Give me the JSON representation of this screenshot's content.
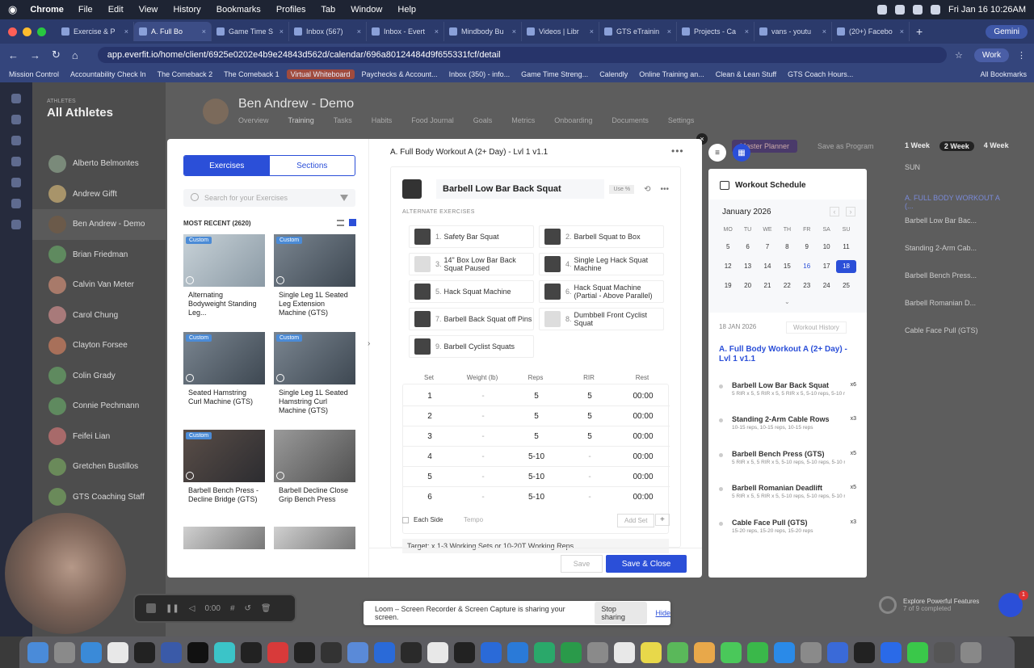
{
  "mac_menu": {
    "apple": "",
    "app": "Chrome",
    "items": [
      "File",
      "Edit",
      "View",
      "History",
      "Bookmarks",
      "Profiles",
      "Tab",
      "Window",
      "Help"
    ],
    "clock": "Fri Jan 16  10:26AM"
  },
  "tabs": [
    {
      "label": "Exercise & P",
      "active": false
    },
    {
      "label": "A. Full Bo",
      "active": true
    },
    {
      "label": "Game Time S",
      "active": false
    },
    {
      "label": "Inbox (567)",
      "active": false
    },
    {
      "label": "Inbox - Evert",
      "active": false
    },
    {
      "label": "Mindbody Bu",
      "active": false
    },
    {
      "label": "Videos | Libr",
      "active": false
    },
    {
      "label": "GTS eTrainin",
      "active": false
    },
    {
      "label": "Projects - Ca",
      "active": false
    },
    {
      "label": "vans - youtu",
      "active": false
    },
    {
      "label": "(20+) Facebo",
      "active": false
    }
  ],
  "gemini": "Gemini",
  "address": "app.everfit.io/home/client/6925e0202e4b9e24843d562d/calendar/696a80124484d9f655331fcf/detail",
  "profile": "Work",
  "bookmarks": [
    "Mission Control",
    "Accountability Check In",
    "The Comeback 2",
    "The Comeback 1",
    "Virtual Whiteboard",
    "Paychecks & Account...",
    "Inbox (350) - info...",
    "Game Time Streng...",
    "Calendly",
    "Online Training an...",
    "Clean & Lean Stuff",
    "GTS Coach Hours...",
    "All Bookmarks"
  ],
  "athletes": {
    "label": "ATHLETES",
    "title": "All Athletes",
    "list": [
      "Alberto Belmontes",
      "Andrew Gifft",
      "Ben Andrew - Demo",
      "Brian Friedman",
      "Calvin Van Meter",
      "Carol Chung",
      "Clayton Forsee",
      "Colin Grady",
      "Connie Pechmann",
      "Feifei Lian",
      "Gretchen Bustillos",
      "GTS Coaching Staff"
    ]
  },
  "client": {
    "name": "Ben Andrew - Demo",
    "tabs": [
      "Overview",
      "Training",
      "Tasks",
      "Habits",
      "Food Journal",
      "Goals",
      "Metrics",
      "Onboarding",
      "Documents",
      "Settings"
    ]
  },
  "calendar_header": {
    "master_planner": "Master Planner",
    "save_as_program": "Save as Program",
    "weeks": [
      "1 Week",
      "2 Week",
      "4 Week"
    ]
  },
  "ghost_column": {
    "sun": "SUN",
    "items": [
      "A. FULL BODY WORKOUT A (...",
      "Barbell Low Bar Bac...",
      "Standing 2-Arm Cab...",
      "Barbell Bench Press...",
      "Barbell Romanian D...",
      "Cable Face Pull (GTS)"
    ]
  },
  "library": {
    "seg_exercises": "Exercises",
    "seg_sections": "Sections",
    "search_placeholder": "Search for your Exercises",
    "most_recent": "MOST RECENT (2620)",
    "cards": [
      {
        "tag": "Custom",
        "title": "Alternating Bodyweight Standing Leg..."
      },
      {
        "tag": "Custom",
        "title": "Single Leg 1L Seated Leg Extension Machine (GTS)"
      },
      {
        "tag": "Custom",
        "title": "Seated Hamstring Curl Machine (GTS)"
      },
      {
        "tag": "Custom",
        "title": "Single Leg 1L Seated Hamstring Curl Machine (GTS)"
      },
      {
        "tag": "Custom",
        "title": "Barbell Bench Press - Decline Bridge (GTS)"
      },
      {
        "tag": "",
        "title": "Barbell Decline Close Grip Bench Press"
      }
    ]
  },
  "editor": {
    "title": "A. Full Body Workout A (2+ Day) - Lvl 1 v1.1",
    "exercise": "Barbell Low Bar Back Squat",
    "use_pct": "Use %",
    "alt_label": "ALTERNATE EXERCISES",
    "alternates": [
      {
        "n": "1.",
        "name": "Safety Bar Squat"
      },
      {
        "n": "2.",
        "name": "Barbell Squat to Box"
      },
      {
        "n": "3.",
        "name": "14\" Box Low Bar Back Squat Paused"
      },
      {
        "n": "4.",
        "name": "Single Leg Hack Squat Machine"
      },
      {
        "n": "5.",
        "name": "Hack Squat Machine"
      },
      {
        "n": "6.",
        "name": "Hack Squat Machine (Partial - Above Parallel)"
      },
      {
        "n": "7.",
        "name": "Barbell Back Squat off Pins"
      },
      {
        "n": "8.",
        "name": "Dumbbell Front Cyclist Squat"
      },
      {
        "n": "9.",
        "name": "Barbell Cyclist Squats"
      }
    ],
    "set_headers": [
      "Set",
      "Weight (lb)",
      "Reps",
      "RIR",
      "Rest"
    ],
    "sets": [
      {
        "set": "1",
        "weight": "-",
        "reps": "5",
        "rir": "5",
        "rest": "00:00"
      },
      {
        "set": "2",
        "weight": "-",
        "reps": "5",
        "rir": "5",
        "rest": "00:00"
      },
      {
        "set": "3",
        "weight": "-",
        "reps": "5",
        "rir": "5",
        "rest": "00:00"
      },
      {
        "set": "4",
        "weight": "-",
        "reps": "5-10",
        "rir": "-",
        "rest": "00:00"
      },
      {
        "set": "5",
        "weight": "-",
        "reps": "5-10",
        "rir": "-",
        "rest": "00:00"
      },
      {
        "set": "6",
        "weight": "-",
        "reps": "5-10",
        "rir": "-",
        "rest": "00:00"
      }
    ],
    "each_side": "Each Side",
    "tempo": "Tempo",
    "add_set": "Add Set",
    "plus": "+",
    "target": "Target: x 1-3 Working Sets or 10-20T Working Reps",
    "save": "Save",
    "save_close": "Save & Close"
  },
  "schedule": {
    "title": "Workout Schedule",
    "month": "January 2026",
    "dows": [
      "MO",
      "TU",
      "WE",
      "TH",
      "FR",
      "SA",
      "SU"
    ],
    "weeks": [
      [
        "5",
        "6",
        "7",
        "8",
        "9",
        "10",
        "11"
      ],
      [
        "12",
        "13",
        "14",
        "15",
        "16",
        "17",
        "18"
      ],
      [
        "19",
        "20",
        "21",
        "22",
        "23",
        "24",
        "25"
      ]
    ],
    "date": "18 JAN 2026",
    "history": "Workout History",
    "workout": "A. Full Body Workout A (2+ Day) - Lvl 1 v1.1",
    "items": [
      {
        "name": "Barbell Low Bar Back Squat",
        "detail": "5 RIR x 5, 5 RIR x 5, 5 RIR x 5, 5-10 reps, 5-10 re",
        "x": "x6"
      },
      {
        "name": "Standing 2-Arm Cable Rows",
        "detail": "10-15 reps, 10-15 reps, 10-15 reps",
        "x": "x3"
      },
      {
        "name": "Barbell Bench Press (GTS)",
        "detail": "5 RIR x 5, 5 RIR x 5, 5-10 reps, 5-10 reps, 5-10 re",
        "x": "x5"
      },
      {
        "name": "Barbell Romanian Deadlift",
        "detail": "5 RIR x 5, 5 RIR x 5, 5-10 reps, 5-10 reps, 5-10 re",
        "x": "x5"
      },
      {
        "name": "Cable Face Pull (GTS)",
        "detail": "15-20 reps, 15-20 reps, 15-20 reps",
        "x": "x3"
      }
    ]
  },
  "loom": {
    "message": "Loom – Screen Recorder & Screen Capture is sharing your screen.",
    "stop": "Stop sharing",
    "hide": "Hide"
  },
  "recorder": {
    "time": "0:00"
  },
  "explore": {
    "title": "Explore Powerful Features",
    "sub": "7 of 9 completed"
  },
  "chat_badge": "1"
}
